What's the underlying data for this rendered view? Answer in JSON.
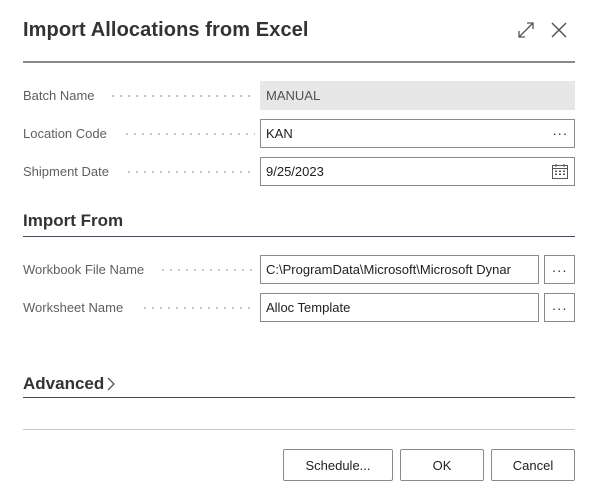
{
  "dialog": {
    "title": "Import Allocations from Excel",
    "expand_icon": "expand-diagonal-icon",
    "close_icon": "close-icon"
  },
  "fields": {
    "batch_name": {
      "label": "Batch Name",
      "value": "MANUAL"
    },
    "location_code": {
      "label": "Location Code",
      "value": "KAN",
      "assist": "···"
    },
    "shipment_date": {
      "label": "Shipment Date",
      "value": "9/25/2023",
      "icon": "calendar-icon"
    }
  },
  "import_from": {
    "title": "Import From",
    "workbook_file_name": {
      "label": "Workbook File Name",
      "value": "C:\\ProgramData\\Microsoft\\Microsoft Dynar",
      "assist": "···"
    },
    "worksheet_name": {
      "label": "Worksheet Name",
      "value": "Alloc Template",
      "assist": "···"
    }
  },
  "advanced": {
    "title": "Advanced",
    "icon": "chevron-right-icon"
  },
  "footer": {
    "schedule_label": "Schedule...",
    "ok_label": "OK",
    "cancel_label": "Cancel"
  },
  "colors": {
    "accent": "#4a4a5a",
    "label_text": "#5f5f5f",
    "readonly_bg": "#e7e7e7",
    "border": "#8a8a8a"
  }
}
